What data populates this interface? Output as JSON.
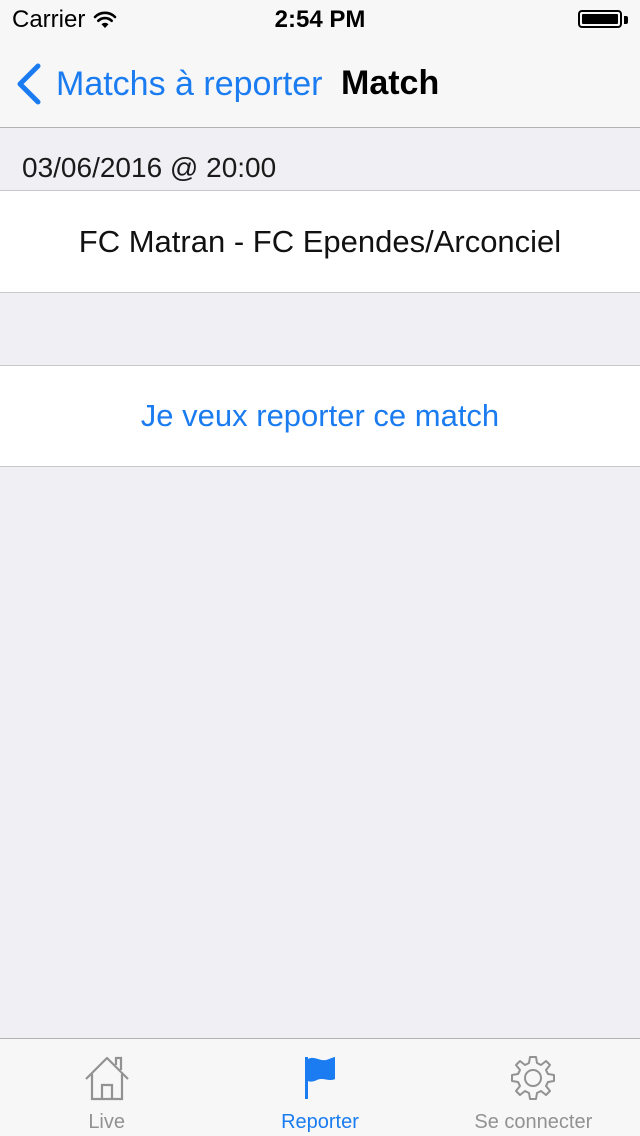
{
  "status_bar": {
    "carrier": "Carrier",
    "time": "2:54 PM"
  },
  "nav": {
    "back_label": "Matchs à reporter",
    "title": "Match"
  },
  "section": {
    "header": "03/06/2016 @ 20:00"
  },
  "match": {
    "teams": "FC Matran - FC Ependes/Arconciel"
  },
  "action": {
    "label": "Je veux reporter ce match"
  },
  "tabbar": {
    "items": [
      {
        "label": "Live",
        "icon": "home-icon"
      },
      {
        "label": "Reporter",
        "icon": "flag-icon"
      },
      {
        "label": "Se connecter",
        "icon": "gear-icon"
      }
    ],
    "active_index": 1
  },
  "colors": {
    "accent": "#1a7cf0",
    "background": "#efeff4",
    "inactive": "#929292"
  }
}
